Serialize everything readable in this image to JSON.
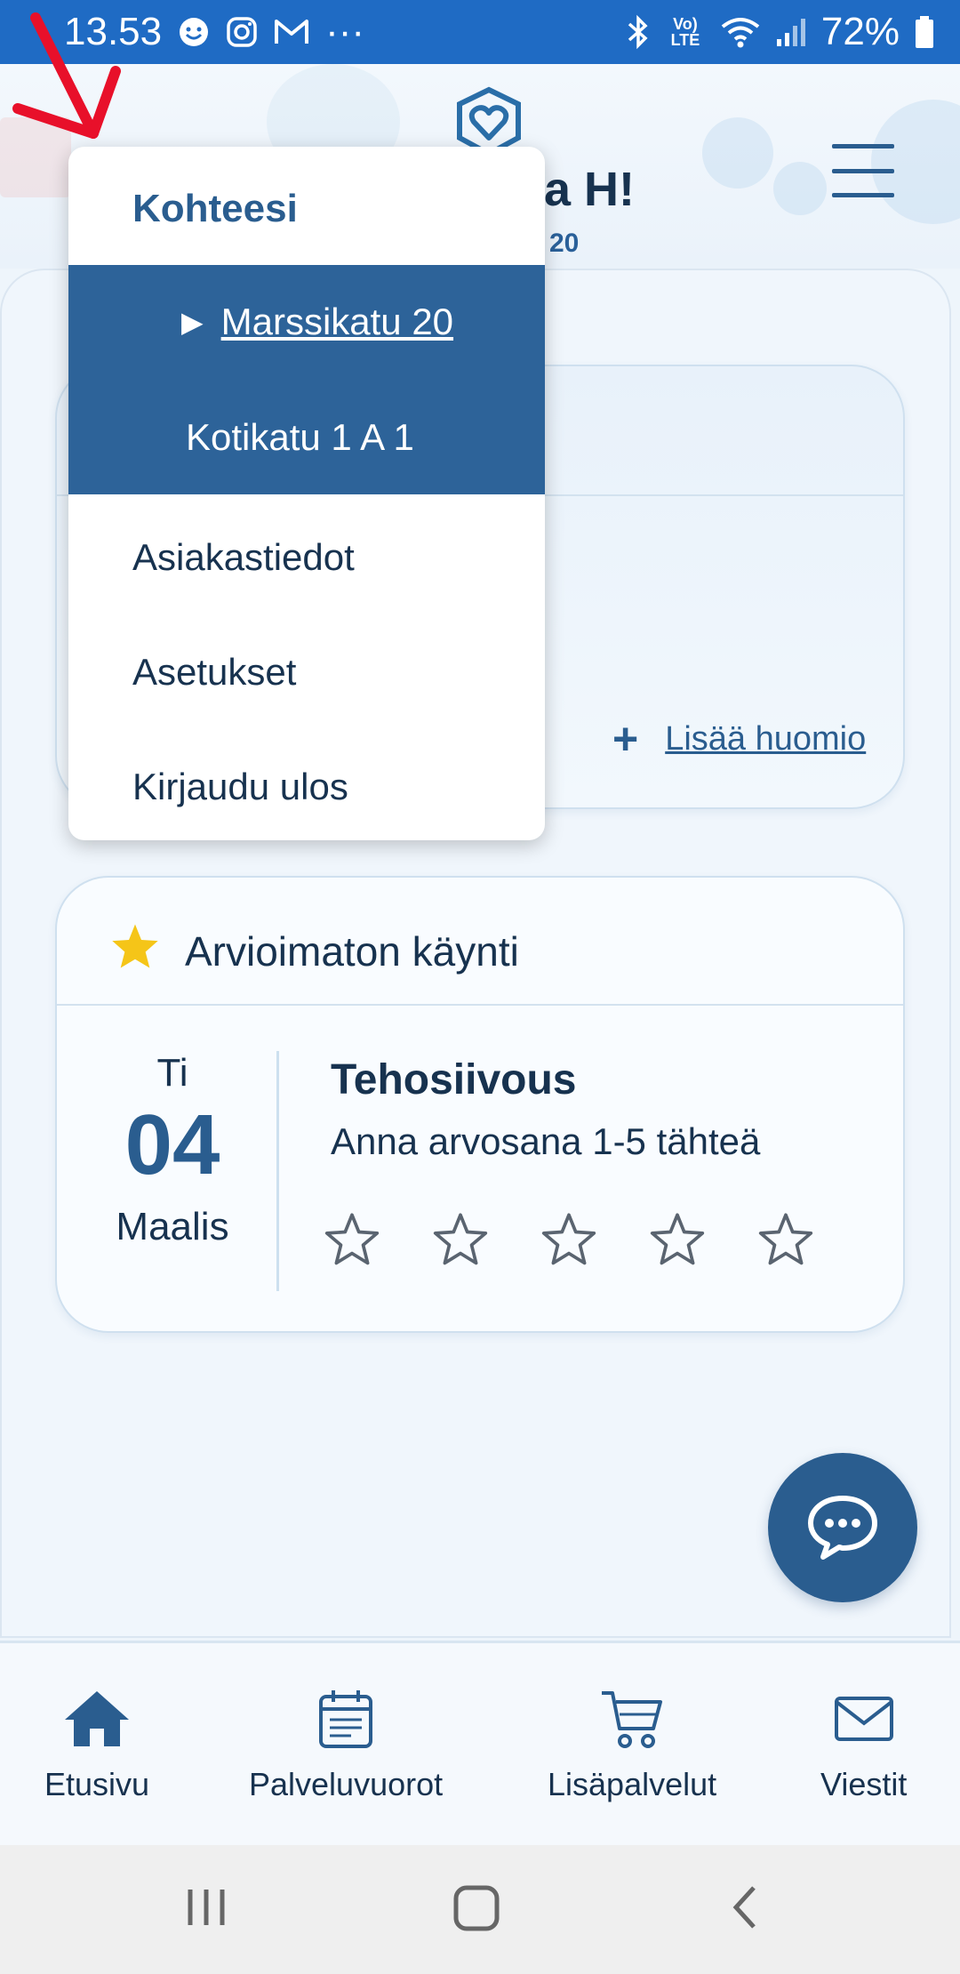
{
  "status_bar": {
    "time": "13.53",
    "battery": "72%",
    "more": "···",
    "network": "Vo) LTE"
  },
  "header": {
    "greeting": "a H!",
    "address_suffix": "20"
  },
  "dropdown": {
    "title": "Kohteesi",
    "sites": [
      {
        "label": "Marssikatu 20",
        "active": true
      },
      {
        "label": "Kotikatu 1 A 1",
        "active": false
      }
    ],
    "items": [
      {
        "label": "Asiakastiedot"
      },
      {
        "label": "Asetukset"
      },
      {
        "label": "Kirjaudu ulos"
      }
    ],
    "active_marker": "▶"
  },
  "notes_card": {
    "add_label": "Lisää huomio",
    "add_icon": "plus-icon"
  },
  "rating_card": {
    "title": "Arvioimaton käynti",
    "title_icon": "star-icon",
    "day_of_week": "Ti",
    "day": "04",
    "month": "Maalis",
    "service_name": "Tehosiivous",
    "hint": "Anna arvosana 1-5 tähteä",
    "star_count": 5,
    "rating": 0
  },
  "bottom_nav": {
    "items": [
      {
        "label": "Etusivu",
        "icon": "home-icon"
      },
      {
        "label": "Palveluvuorot",
        "icon": "calendar-icon"
      },
      {
        "label": "Lisäpalvelut",
        "icon": "cart-icon"
      },
      {
        "label": "Viestit",
        "icon": "mail-icon"
      }
    ]
  },
  "colors": {
    "status_bar": "#1f6bc4",
    "primary": "#2a5d8f",
    "dropdown_sites_bg": "#2d6399",
    "star_accent": "#f5c518",
    "annotation": "#e8102a"
  }
}
